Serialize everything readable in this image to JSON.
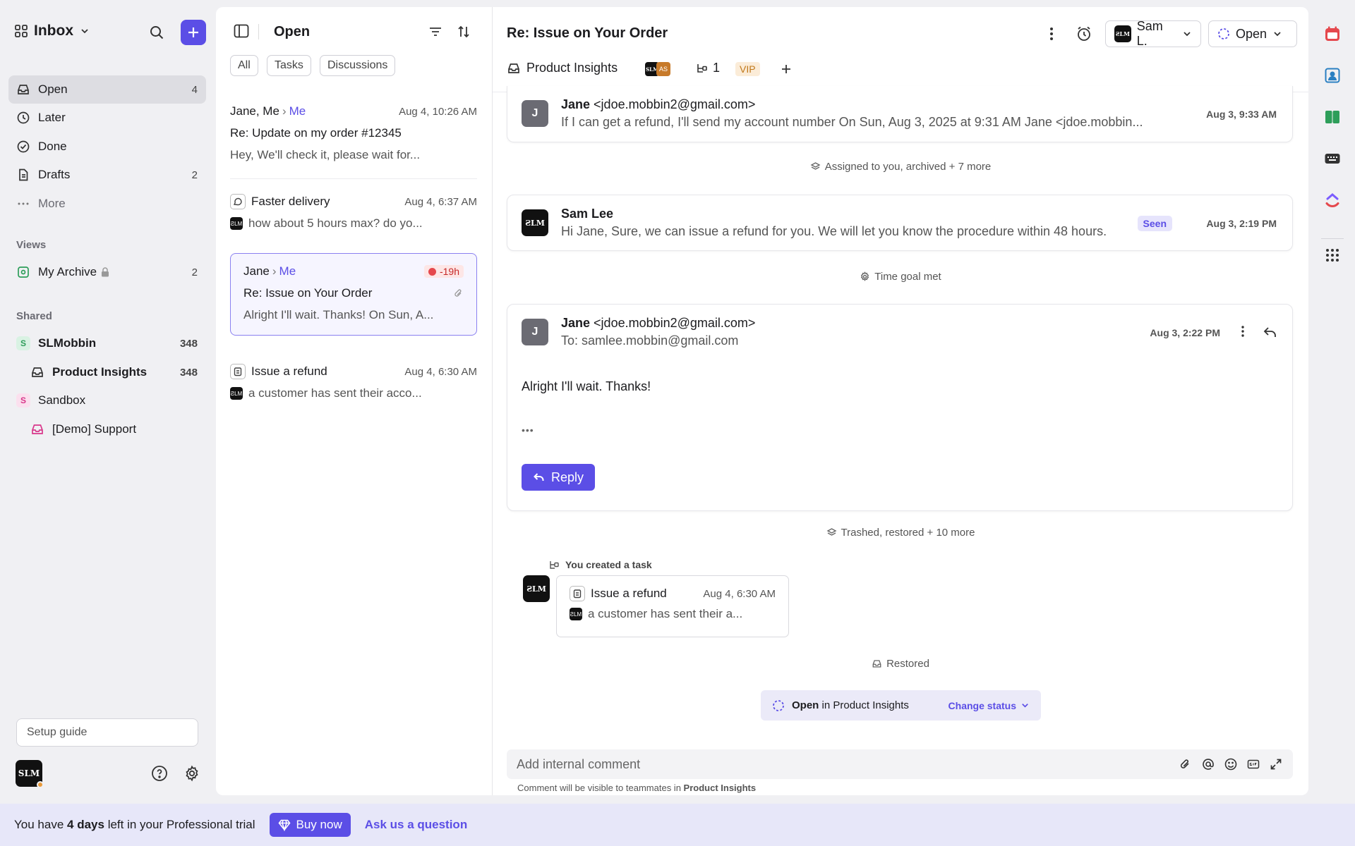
{
  "sidebar": {
    "workspace_title": "Inbox",
    "nav": [
      {
        "label": "Open",
        "count": "4"
      },
      {
        "label": "Later",
        "count": ""
      },
      {
        "label": "Done",
        "count": ""
      },
      {
        "label": "Drafts",
        "count": "2"
      },
      {
        "label": "More",
        "count": ""
      }
    ],
    "views_label": "Views",
    "views": [
      {
        "label": "My Archive",
        "count": "2"
      }
    ],
    "shared_label": "Shared",
    "shared": [
      {
        "badge": "S",
        "label": "SLMobbin",
        "count": "348"
      },
      {
        "label": "Product Insights",
        "count": "348"
      },
      {
        "badge": "S",
        "label": "Sandbox",
        "count": ""
      },
      {
        "label": "[Demo] Support",
        "count": ""
      }
    ],
    "setup_guide": "Setup guide",
    "avatar_text": "SLM"
  },
  "list": {
    "title": "Open",
    "filters": [
      "All",
      "Tasks",
      "Discussions"
    ],
    "conversations": [
      {
        "from": "Jane, Me",
        "to": "Me",
        "time": "Aug 4, 10:26 AM",
        "subject": "Re: Update on my order #12345",
        "preview": "Hey, We'll check it, please wait for..."
      },
      {
        "from": "Faster delivery",
        "time": "Aug 4, 6:37 AM",
        "preview": "how about 5 hours max? do yo..."
      },
      {
        "from": "Jane",
        "to": "Me",
        "badge": "-19h",
        "subject": "Re: Issue on Your Order",
        "preview": "Alright I'll wait. Thanks! On Sun, A..."
      },
      {
        "from": "Issue a refund",
        "time": "Aug 4, 6:30 AM",
        "preview": "a customer has sent their acco..."
      }
    ]
  },
  "thread": {
    "title": "Re: Issue on Your Order",
    "assignee": "Sam L.",
    "status": "Open",
    "team": "Product Insights",
    "avatar_stack": [
      "SLM",
      "AS"
    ],
    "task_count": "1",
    "tag": "VIP",
    "messages": [
      {
        "sender": "Jane",
        "email": "<jdoe.mobbin2@gmail.com>",
        "preview": "If I can get a refund, I'll send my account number On Sun, Aug 3, 2025 at 9:31 AM Jane <jdoe.mobbin...",
        "time": "Aug 3, 9:33 AM"
      },
      {
        "sender": "Sam Lee",
        "preview": "Hi Jane, Sure, we can issue a refund for you. We will let you know the procedure within 48 hours.",
        "badge": "Seen",
        "time": "Aug 3, 2:19 PM"
      },
      {
        "sender": "Jane",
        "email": "<jdoe.mobbin2@gmail.com>",
        "to": "To: samlee.mobbin@gmail.com",
        "body": "Alright I'll wait. Thanks!",
        "ellipsis": "•••",
        "time": "Aug 3, 2:22 PM",
        "reply_label": "Reply"
      }
    ],
    "events": {
      "assigned": "Assigned to you, archived + 7 more",
      "time_goal": "Time goal met",
      "trashed": "Trashed, restored + 10 more",
      "created_task": "You created a task",
      "restored": "Restored"
    },
    "task_card": {
      "title": "Issue a refund",
      "time": "Aug 4, 6:30 AM",
      "preview": "a customer has sent their a..."
    },
    "status_bar": {
      "status": "Open",
      "in_text": "in Product Insights",
      "change": "Change status"
    },
    "comment": {
      "placeholder": "Add internal comment",
      "note_prefix": "Comment will be visible to teammates in",
      "note_team": "Product Insights"
    }
  },
  "banner": {
    "prefix": "You have",
    "days": "4 days",
    "suffix": "left in your Professional trial",
    "buy": "Buy now",
    "ask": "Ask us a question"
  },
  "colors": {
    "accent": "#5b4ee6",
    "urgent": "#e5484d",
    "vip": "#c0781a"
  }
}
